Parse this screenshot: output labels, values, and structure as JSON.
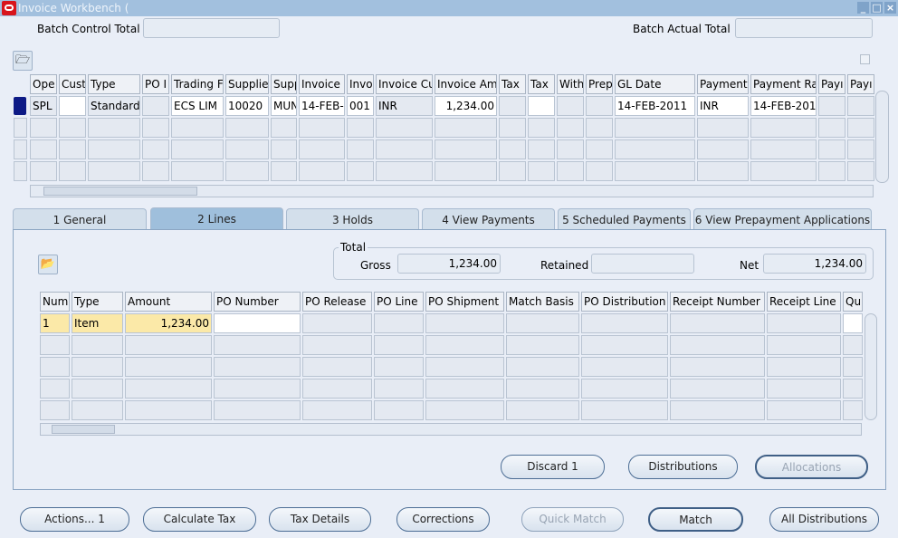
{
  "window": {
    "title": "Invoice Workbench (",
    "buttons": [
      "minimize",
      "maximize",
      "close"
    ]
  },
  "batch": {
    "control_total_label": "Batch Control Total",
    "control_total_value": "",
    "actual_total_label": "Batch Actual Total",
    "actual_total_value": ""
  },
  "invoices": {
    "columns": [
      "Ope",
      "Cust",
      "Type",
      "PO I",
      "Trading F",
      "Supplie",
      "Supp",
      "Invoice D",
      "Invoi",
      "Invoice Cu",
      "Invoice Amo",
      "Tax",
      "Tax",
      "With",
      "Prep",
      "GL Date",
      "Payment",
      "Payment Ra",
      "Payı",
      "Payı"
    ],
    "rows": [
      [
        "SPL",
        "",
        "Standard",
        "",
        "ECS LIM",
        "10020",
        "MUN",
        "14-FEB-",
        "001",
        "INR",
        "1,234.00",
        "",
        "",
        "",
        "",
        "14-FEB-2011",
        "INR",
        "14-FEB-201",
        "",
        ""
      ]
    ]
  },
  "tabs": [
    {
      "label": "1 General"
    },
    {
      "label": "2 Lines",
      "active": true
    },
    {
      "label": "3 Holds"
    },
    {
      "label": "4 View Payments"
    },
    {
      "label": "5 Scheduled Payments"
    },
    {
      "label": "6 View Prepayment Applications"
    }
  ],
  "totals": {
    "group_label": "Total",
    "gross_label": "Gross",
    "gross": "1,234.00",
    "retained_label": "Retained",
    "retained": "",
    "net_label": "Net",
    "net": "1,234.00"
  },
  "lines": {
    "columns": [
      "Num",
      "Type",
      "Amount",
      "PO Number",
      "PO Release",
      "PO Line",
      "PO Shipment",
      "Match Basis",
      "PO Distribution",
      "Receipt Number",
      "Receipt Line",
      "Qu"
    ],
    "rows": [
      [
        "1",
        "Item",
        "1,234.00",
        "",
        "",
        "",
        "",
        "",
        "",
        "",
        "",
        ""
      ]
    ]
  },
  "panel_buttons": {
    "discard": "Discard 1",
    "distributions": "Distributions",
    "allocations": "Allocations"
  },
  "bottom_buttons": {
    "actions": "Actions... 1",
    "calculate_tax": "Calculate Tax",
    "tax_details": "Tax Details",
    "corrections": "Corrections",
    "quick_match": "Quick Match",
    "match": "Match",
    "all_distributions": "All Distributions"
  }
}
